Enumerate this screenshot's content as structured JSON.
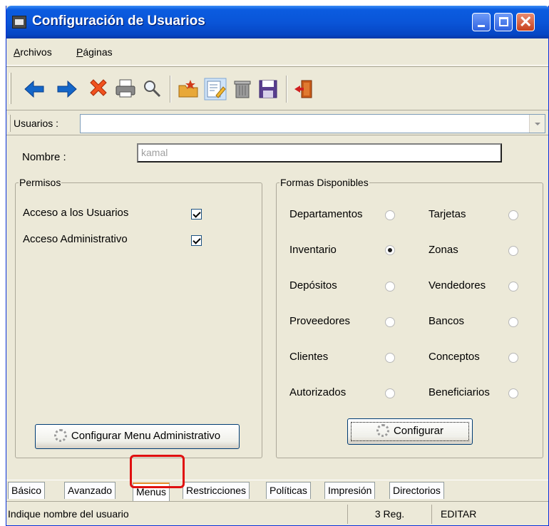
{
  "window": {
    "title": "Configuración de Usuarios"
  },
  "menu": {
    "archivos_ul": "A",
    "archivos_rest": "rchivos",
    "paginas_ul": "P",
    "paginas_rest": "áginas"
  },
  "toolbar": {
    "icons": [
      "back-arrow-icon",
      "forward-arrow-icon",
      "delete-x-icon",
      "print-icon",
      "search-icon",
      "new-folder-icon",
      "edit-icon",
      "trash-icon",
      "save-icon",
      "exit-icon"
    ]
  },
  "usuarios": {
    "label": "Usuarios :",
    "value": ""
  },
  "nombre": {
    "label": "Nombre :",
    "value": "kamal"
  },
  "permisos": {
    "legend": "Permisos",
    "items": [
      {
        "label": "Acceso  a los Usuarios",
        "checked": true
      },
      {
        "label": "Acceso  Administrativo",
        "checked": true
      }
    ],
    "button_label": "Configurar Menu Administrativo"
  },
  "formas": {
    "legend": "Formas Disponibles",
    "left": [
      {
        "label": "Departamentos",
        "checked": false
      },
      {
        "label": "Inventario",
        "checked": true
      },
      {
        "label": "Depósitos",
        "checked": false
      },
      {
        "label": "Proveedores",
        "checked": false
      },
      {
        "label": "Clientes",
        "checked": false
      },
      {
        "label": "Autorizados",
        "checked": false
      }
    ],
    "right": [
      {
        "label": "Tarjetas",
        "checked": false
      },
      {
        "label": "Zonas",
        "checked": false
      },
      {
        "label": "Vendedores",
        "checked": false
      },
      {
        "label": "Bancos",
        "checked": false
      },
      {
        "label": "Conceptos",
        "checked": false
      },
      {
        "label": "Beneficiarios",
        "checked": false
      }
    ],
    "button_label": "Configurar"
  },
  "tabs": [
    {
      "label": "Básico"
    },
    {
      "label": "Avanzado"
    },
    {
      "label": "Menus",
      "active": true
    },
    {
      "label": "Restricciones"
    },
    {
      "label": "Políticas"
    },
    {
      "label": "Impresión"
    },
    {
      "label": "Directorios"
    }
  ],
  "status": {
    "message": "Indique nombre del usuario",
    "records": "3 Reg.",
    "mode": "EDITAR"
  },
  "colors": {
    "title_blue": "#0a55d8",
    "highlight": "#e01010",
    "window_bg": "#ece9d8"
  }
}
